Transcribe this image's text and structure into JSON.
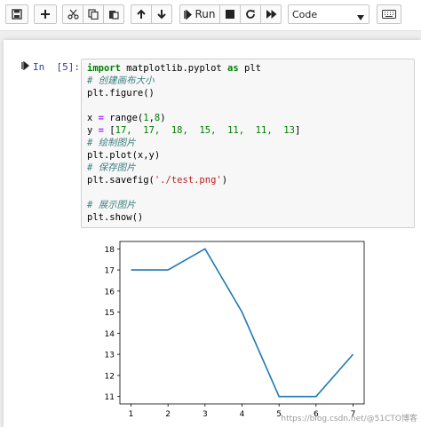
{
  "toolbar": {
    "run_label": "Run",
    "cell_type": "Code",
    "icons": [
      "save-icon",
      "add-cell-icon",
      "cut-icon",
      "copy-icon",
      "paste-icon",
      "move-up-icon",
      "move-down-icon",
      "run-icon",
      "stop-icon",
      "restart-icon",
      "fast-forward-icon",
      "keyboard-icon"
    ]
  },
  "cell": {
    "prompt": "In  [5]:",
    "code": {
      "l1_kw": "import",
      "l1_rest": " matplotlib.pyplot ",
      "l1_as": "as",
      "l1_end": " plt",
      "l2": "# 创建画布大小",
      "l3": "plt.figure()",
      "l5_a": "x ",
      "l5_eq": "=",
      "l5_b": " range(",
      "l5_n1": "1",
      "l5_c": ",",
      "l5_n2": "8",
      "l5_d": ")",
      "l6_a": "y ",
      "l6_eq": "=",
      "l6_b": " [",
      "l6_nums": "17,  17,  18,  15,  11,  11,  13",
      "l6_c": "]",
      "l7": "# 绘制图片",
      "l8": "plt.plot(x,y)",
      "l9": "# 保存图片",
      "l10_a": "plt.savefig(",
      "l10_s": "'./test.png'",
      "l10_b": ")",
      "l12": "# 展示图片",
      "l13": "plt.show()"
    }
  },
  "watermark": "https://blog.csdn.net/@51CTO博客",
  "chart_data": {
    "type": "line",
    "x": [
      1,
      2,
      3,
      4,
      5,
      6,
      7
    ],
    "series": [
      {
        "values": [
          17,
          17,
          18,
          15,
          11,
          11,
          13
        ],
        "color": "#1f77b4"
      }
    ],
    "xticks": [
      "1",
      "2",
      "3",
      "4",
      "5",
      "6",
      "7"
    ],
    "yticks": [
      "11",
      "12",
      "13",
      "14",
      "15",
      "16",
      "17",
      "18"
    ],
    "xlim": [
      0.7,
      7.3
    ],
    "ylim": [
      10.65,
      18.35
    ],
    "title": "",
    "xlabel": "",
    "ylabel": "",
    "grid": false
  }
}
